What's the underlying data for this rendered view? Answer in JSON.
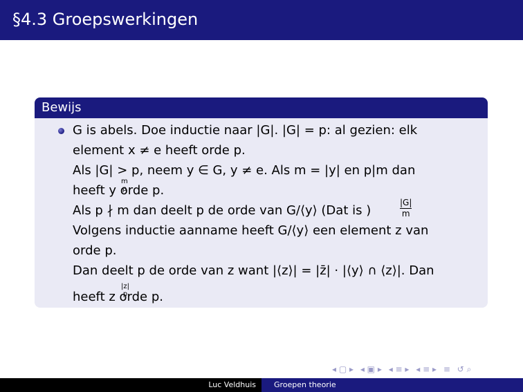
{
  "slide": {
    "title": "§4.3 Groepswerkingen"
  },
  "block": {
    "heading": "Bewijs",
    "lines": [
      "G is abels. Doe inductie naar |G|. |G| = p: al gezien: elk",
      "element x ≠ e heeft orde p.",
      "Als |G| > p, neem y ∈ G, y ≠ e. Als m = |y| en p|m dan",
      "heeft y     orde p.",
      "Als p ∤ m dan deelt p de orde van G/⟨y⟩ (Dat is      )",
      "Volgens inductie aanname heeft G/⟨y⟩ een element z van",
      "orde p.",
      "Dan deelt p de orde van z want |⟨z⟩| = |z̄| · |⟨y⟩ ∩ ⟨z⟩|. Dan",
      "heeft z     orde p."
    ],
    "sup1_num": "m",
    "sup1_den": "p",
    "frac_num": "|G|",
    "frac_den": "m",
    "sup2_num": "|z|",
    "sup2_den": "p"
  },
  "footer": {
    "author": "Luc Veldhuis",
    "topic": "Groepen theorie"
  },
  "nav": {
    "glyphs": [
      "◂ ▢ ▸",
      "◂ ▣ ▸",
      "◂ ≡ ▸",
      "◂ ≡ ▸",
      "≡",
      "↺ ⌕"
    ]
  }
}
